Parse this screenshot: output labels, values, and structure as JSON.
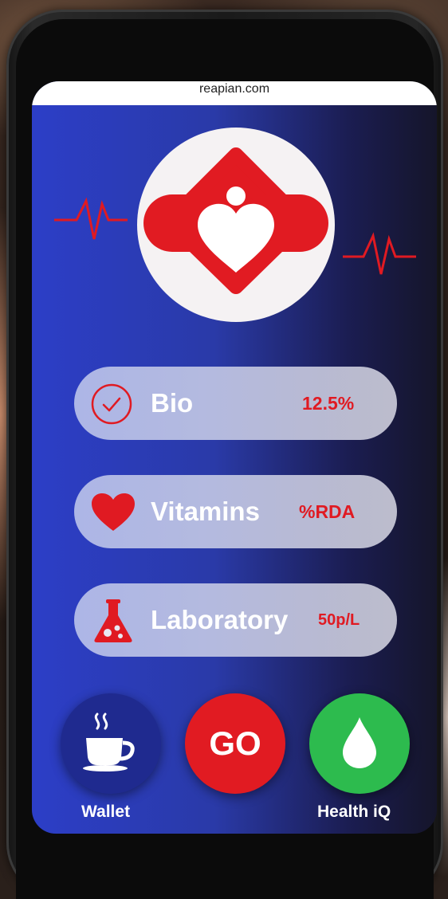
{
  "browser": {
    "url": "reapian.com"
  },
  "rows": [
    {
      "label": "Bio",
      "value": "12.5%",
      "icon": "check-circle-icon"
    },
    {
      "label": "Vitamins",
      "value": "%RDA",
      "icon": "heart-icon"
    },
    {
      "label": "Laboratory",
      "value": "50p/L",
      "icon": "flask-icon"
    }
  ],
  "buttons": {
    "wallet": {
      "label": "Wallet",
      "icon": "coffee-cup-icon",
      "color": "#1f2a8f"
    },
    "go": {
      "label": "GO",
      "color": "#e11b22"
    },
    "health": {
      "label": "Health iQ",
      "icon": "water-drop-icon",
      "color": "#2dbb4e"
    }
  },
  "colors": {
    "accent_red": "#e01a22",
    "screen_blue": "#2c3ec7"
  }
}
